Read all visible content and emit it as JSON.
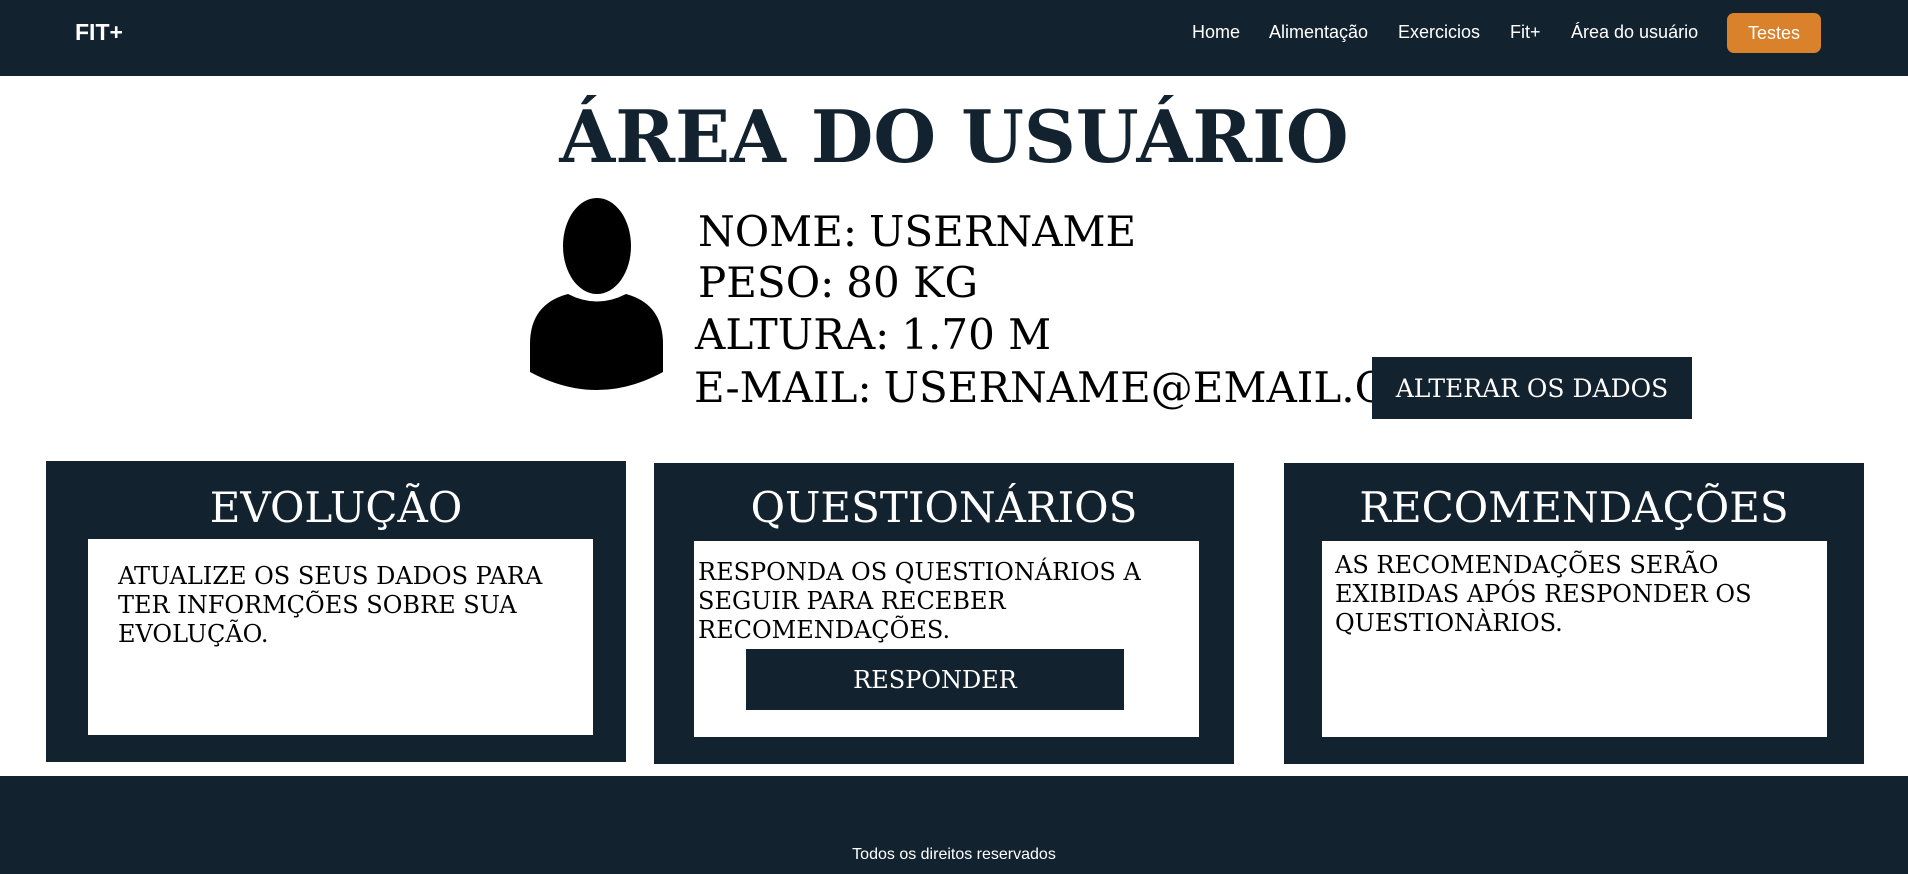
{
  "nav": {
    "brand": "FIT+",
    "links": [
      "Home",
      "Alimentação",
      "Exercicios",
      "Fit+",
      "Área do usuário"
    ],
    "button": "Testes"
  },
  "page": {
    "title": "ÁREA DO USUÁRIO"
  },
  "user": {
    "avatar_icon": "user-silhouette-icon",
    "name_label": "NOME:",
    "name_value": "USERNAME",
    "weight_label": "PESO:",
    "weight_value": "80 KG",
    "height_label": "ALTURA:",
    "height_value": "1.70 M",
    "email_label": "E-MAIL:",
    "email_value": "USERNAME@EMAIL.COM",
    "edit_button": "ALTERAR OS DADOS"
  },
  "cards": [
    {
      "title": "EVOLUÇÃO",
      "text": "ATUALIZE OS SEUS DADOS PARA TER INFORMÇÕES SOBRE SUA EVOLUÇÃO."
    },
    {
      "title": "QUESTIONÁRIOS",
      "text": "RESPONDA OS QUESTIONÁRIOS A SEGUIR PARA RECEBER RECOMENDAÇÕES.",
      "button": "RESPONDER"
    },
    {
      "title": "RECOMENDAÇÕES",
      "text": "AS RECOMENDAÇÕES SERÃO EXIBIDAS APÓS RESPONDER OS QUESTIONÀRIOS."
    }
  ],
  "footer": {
    "text": "Todos os direitos reservados"
  },
  "colors": {
    "dark": "#13222f",
    "accent": "#d9822b",
    "background": "#ffffff"
  }
}
